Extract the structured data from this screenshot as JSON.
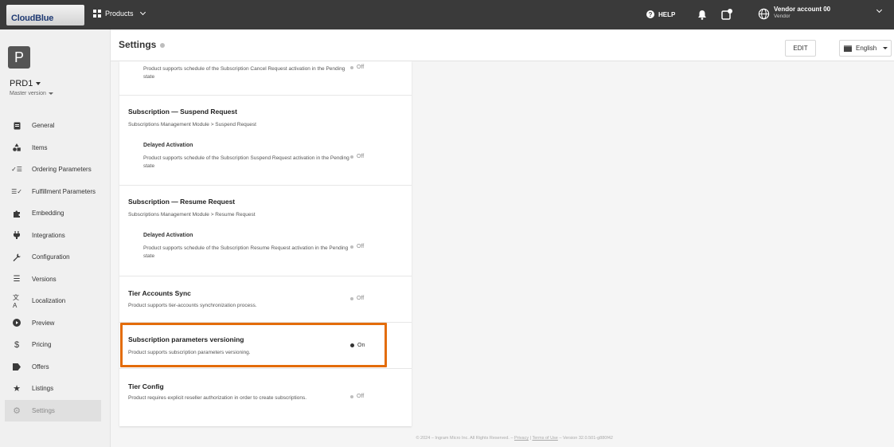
{
  "topbar": {
    "brand": "CloudBlue",
    "products_label": "Products",
    "help_label": "HELP",
    "account_name": "Vendor account 00",
    "account_role": "Vendor"
  },
  "sidebar": {
    "avatar_letter": "P",
    "product_name": "PRD1",
    "version_label": "Master version",
    "items": [
      {
        "label": "General",
        "icon": "document-icon"
      },
      {
        "label": "Items",
        "icon": "items-icon"
      },
      {
        "label": "Ordering Parameters",
        "icon": "ordering-params-icon"
      },
      {
        "label": "Fulfillment Parameters",
        "icon": "fulfillment-params-icon"
      },
      {
        "label": "Embedding",
        "icon": "puzzle-icon"
      },
      {
        "label": "Integrations",
        "icon": "plug-icon"
      },
      {
        "label": "Configuration",
        "icon": "wrench-icon"
      },
      {
        "label": "Versions",
        "icon": "list-icon"
      },
      {
        "label": "Localization",
        "icon": "translate-icon"
      },
      {
        "label": "Preview",
        "icon": "play-icon"
      },
      {
        "label": "Pricing",
        "icon": "dollar-icon"
      },
      {
        "label": "Offers",
        "icon": "tag-icon"
      },
      {
        "label": "Listings",
        "icon": "star-icon"
      },
      {
        "label": "Settings",
        "icon": "gear-icon"
      }
    ]
  },
  "header": {
    "title": "Settings",
    "edit_label": "EDIT",
    "language_label": "English"
  },
  "sections": {
    "cancel_desc": "Product supports schedule of the Subscription Cancel Request activation in the Pending state",
    "cancel_status": "Off",
    "suspend_title": "Subscription — Suspend Request",
    "suspend_path": "Subscriptions Management Module > Suspend Request",
    "suspend_sub_title": "Delayed Activation",
    "suspend_desc": "Product supports schedule of the Subscription Suspend Request activation in the Pending state",
    "suspend_status": "Off",
    "resume_title": "Subscription — Resume Request",
    "resume_path": "Subscriptions Management Module > Resume Request",
    "resume_sub_title": "Delayed Activation",
    "resume_desc": "Product supports schedule of the Subscription Resume Request activation in the Pending state",
    "resume_status": "Off",
    "tier_sync_title": "Tier Accounts Sync",
    "tier_sync_desc": "Product supports tier-accounts synchronization process.",
    "tier_sync_status": "Off",
    "params_title": "Subscription parameters versioning",
    "params_desc": "Product supports subscription parameters versioning.",
    "params_status": "On",
    "tier_config_title": "Tier Config",
    "tier_config_desc": "Product requires explicit reseller authorization in order to create subscriptions.",
    "tier_config_status": "Off"
  },
  "footer": {
    "text_before": "© 2024 – Ingram Micro Inc. All Rights Reserved. – ",
    "privacy": "Privacy",
    "separator": " | ",
    "terms": "Terms of Use",
    "version": " – Version 32.0.501-g880f42"
  },
  "colors": {
    "highlight": "#e36c0a",
    "topbar": "#3a3a3a"
  }
}
